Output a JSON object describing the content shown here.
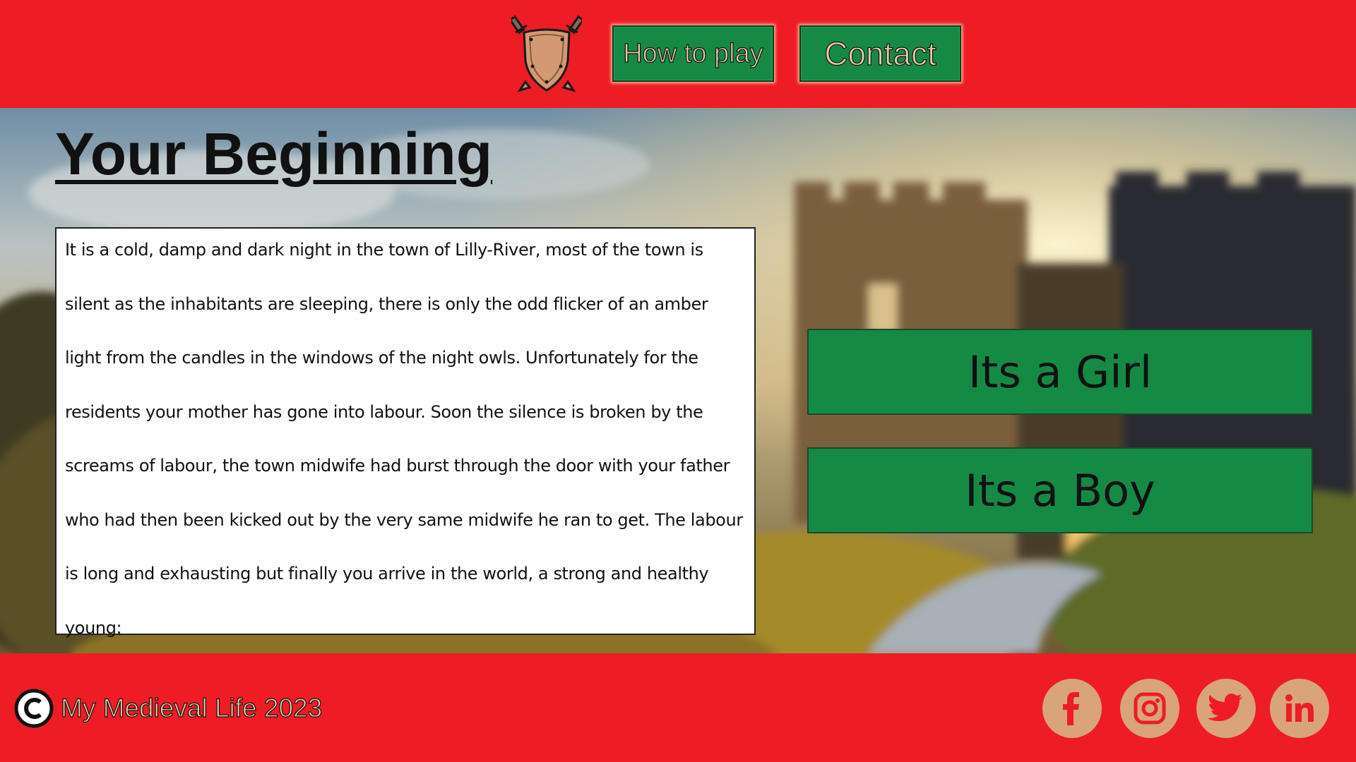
{
  "header": {
    "logo_icon": "shield-crossed-swords-icon",
    "nav": {
      "how_to_play": "How to play",
      "contact": "Contact"
    }
  },
  "main": {
    "title": "Your Beginning",
    "story": "It is a cold, damp and dark night in the town of Lilly-River, most of the town is silent as the inhabitants are sleeping, there is only the odd flicker of an amber light from the candles in the windows of the night owls. Unfortunately for the residents your mother has gone into labour. Soon the silence is broken by the screams of labour, the town midwife had burst through the door with your father who had then been kicked out by the very same midwife he ran to get. The labour is long and exhausting but finally you arrive in the world, a strong and healthy young:",
    "choices": {
      "girl": "Its a Girl",
      "boy": "Its a Boy"
    },
    "background": "castle-landscape"
  },
  "footer": {
    "copyright_icon": "copyright-icon",
    "copyright_text": "My Medieval Life 2023",
    "social": [
      "facebook-icon",
      "instagram-icon",
      "twitter-icon",
      "linkedin-icon"
    ]
  },
  "colors": {
    "primary_red": "#ee1c25",
    "button_green": "#148a45",
    "social_tan": "#d9a37c",
    "label_tan": "#e9c9a8"
  }
}
